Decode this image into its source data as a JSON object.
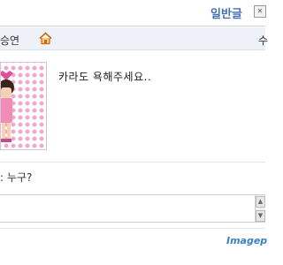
{
  "header": {
    "post_type": "일반글",
    "post_type_icon": "board-icon"
  },
  "info": {
    "author_partial": "승연",
    "home_icon": "home-icon",
    "right_partial": "수"
  },
  "post": {
    "body": "카라도 욕해주세요..",
    "avatar_pattern_color": "#f3a6c8"
  },
  "comment": {
    "text": ": 누구?"
  },
  "watermark": {
    "text": "Imagep"
  },
  "colors": {
    "accent": "#4671b0",
    "info_bar_bg": "#eef2f8",
    "watermark": "#3c7fc4"
  }
}
